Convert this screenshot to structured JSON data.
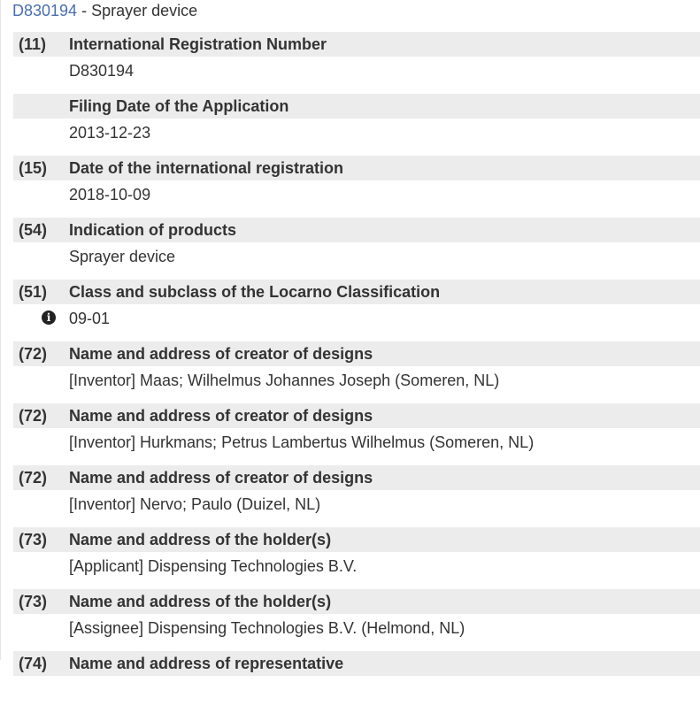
{
  "header": {
    "link": "D830194",
    "separator": " - ",
    "title": "Sprayer device"
  },
  "records": [
    {
      "code": "(11)",
      "label": "International Registration Number",
      "value": "D830194"
    },
    {
      "code": "",
      "label": "Filing Date of the Application",
      "value": "2013-12-23"
    },
    {
      "code": "(15)",
      "label": "Date of the international registration",
      "value": "2018-10-09"
    },
    {
      "code": "(54)",
      "label": "Indication of products",
      "value": "Sprayer device"
    },
    {
      "code": "(51)",
      "label": "Class and subclass of the Locarno Classification",
      "value": "09-01",
      "icon": "info-icon"
    },
    {
      "code": "(72)",
      "label": "Name and address of creator of designs",
      "value": "[Inventor] Maas; Wilhelmus Johannes Joseph (Someren, NL)"
    },
    {
      "code": "(72)",
      "label": "Name and address of creator of designs",
      "value": "[Inventor] Hurkmans; Petrus Lambertus Wilhelmus (Someren, NL)"
    },
    {
      "code": "(72)",
      "label": "Name and address of creator of designs",
      "value": "[Inventor] Nervo; Paulo (Duizel, NL)"
    },
    {
      "code": "(73)",
      "label": "Name and address of the holder(s)",
      "value": "[Applicant]  Dispensing Technologies B.V."
    },
    {
      "code": "(73)",
      "label": "Name and address of the holder(s)",
      "value": "[Assignee]  Dispensing Technologies B.V. (Helmond, NL)"
    },
    {
      "code": "(74)",
      "label": "Name and address of representative",
      "value": ""
    }
  ],
  "colors": {
    "link": "#4a6ea9",
    "bar": "#ececec",
    "text": "#333333"
  }
}
